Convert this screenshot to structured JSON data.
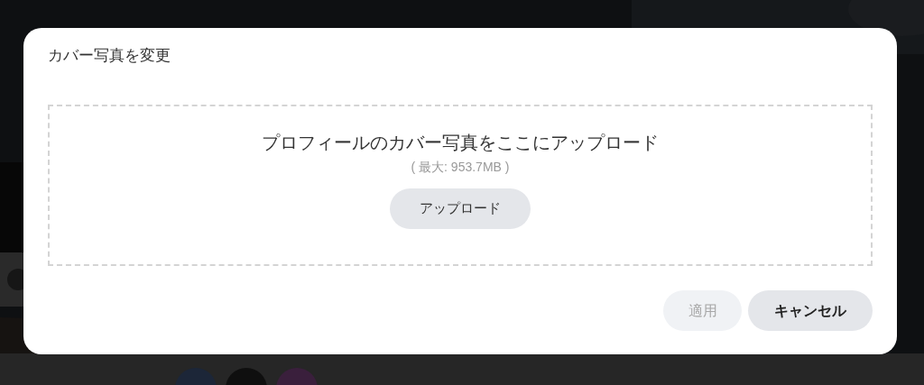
{
  "dialog": {
    "title": "カバー写真を変更",
    "dropzone": {
      "prompt": "プロフィールのカバー写真をここにアップロード",
      "limit": "( 最大: 953.7MB )",
      "button": "アップロード"
    },
    "buttons": [
      {
        "kind": "apply",
        "label": "適用",
        "disabled": true
      },
      {
        "kind": "cancel",
        "label": "キャンセル",
        "disabled": false
      }
    ]
  }
}
